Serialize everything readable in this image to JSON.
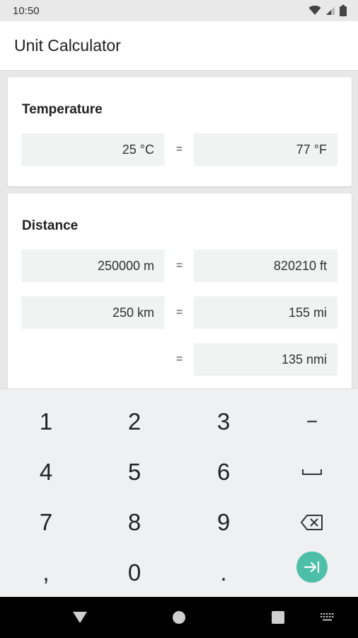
{
  "status_bar": {
    "time": "10:50",
    "icons": [
      "wifi-icon",
      "signal-icon",
      "battery-icon"
    ]
  },
  "app_bar": {
    "title": "Unit Calculator"
  },
  "cards": {
    "temperature": {
      "title": "Temperature",
      "rows": [
        {
          "left": "25 °C",
          "eq": "=",
          "right": "77 °F"
        }
      ]
    },
    "distance": {
      "title": "Distance",
      "rows": [
        {
          "left": "250000 m",
          "eq": "=",
          "right": "820210 ft"
        },
        {
          "left": "250 km",
          "eq": "=",
          "right": "155 mi"
        },
        {
          "left": "",
          "eq": "=",
          "right": "135 nmi"
        }
      ]
    }
  },
  "keypad": {
    "k1": "1",
    "k2": "2",
    "k3": "3",
    "minus": "−",
    "k4": "4",
    "k5": "5",
    "k6": "6",
    "space": "⎵",
    "k7": "7",
    "k8": "8",
    "k9": "9",
    "comma": ",",
    "k0": "0",
    "dot": ".",
    "backspace_icon": "backspace-icon",
    "enter_icon": "next-field-icon"
  },
  "colors": {
    "accent": "#4dbfa9",
    "field_bg": "#f1f3f3",
    "keypad_bg": "#eef0f1"
  },
  "nav_bar": {
    "icons": [
      "back-icon",
      "home-icon",
      "recents-icon",
      "keyboard-switch-icon"
    ]
  }
}
